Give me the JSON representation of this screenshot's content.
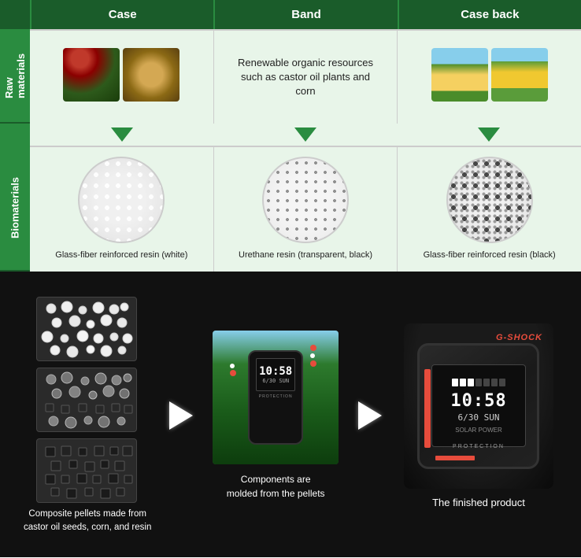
{
  "header": {
    "col1": "Case",
    "col2": "Band",
    "col3": "Case back"
  },
  "rows": {
    "raw_label": "Raw\nmaterials",
    "bio_label": "Biomaterials"
  },
  "raw_materials": {
    "band_text": "Renewable organic resources\nsuch as castor oil plants and corn"
  },
  "biomaterials": {
    "case_caption": "Glass-fiber reinforced resin (white)",
    "band_caption": "Urethane resin (transparent, black)",
    "caseback_caption": "Glass-fiber reinforced resin (black)"
  },
  "bottom": {
    "pellets_caption": "Composite pellets made from\ncastor oil seeds, corn, and resin",
    "molded_caption": "Components are\nmolded from the pellets",
    "finished_caption": "The finished product",
    "watch_time": "10:58",
    "watch_date": "6/30 SUN",
    "brand": "G-SHOCK"
  }
}
